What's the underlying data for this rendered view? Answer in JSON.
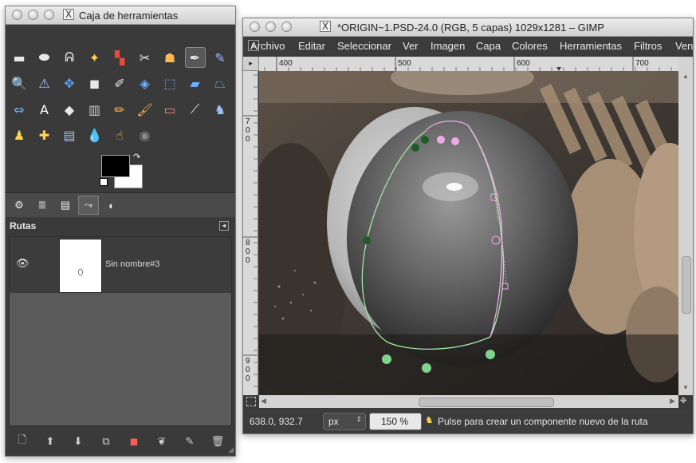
{
  "toolbox": {
    "title": "Caja de herramientas",
    "tools": [
      {
        "name": "rect-select-icon",
        "glyph": "▬",
        "color": "#e8e8e8"
      },
      {
        "name": "ellipse-select-icon",
        "glyph": "⬬",
        "color": "#e8e8e8"
      },
      {
        "name": "free-select-icon",
        "glyph": "ᕱ",
        "color": "#e8e8e8"
      },
      {
        "name": "fuzzy-select-icon",
        "glyph": "✦",
        "color": "#ffd34d"
      },
      {
        "name": "color-select-icon",
        "glyph": "▚",
        "color": "#e84a3c"
      },
      {
        "name": "scissors-select-icon",
        "glyph": "✂",
        "color": "#e8e8e8"
      },
      {
        "name": "foreground-select-icon",
        "glyph": "☗",
        "color": "#ffb84d"
      },
      {
        "name": "paths-tool-icon",
        "glyph": "✒",
        "color": "#e8e8e8"
      },
      {
        "name": "color-picker-icon",
        "glyph": "✎",
        "color": "#8fb8ff"
      },
      {
        "name": "zoom-icon",
        "glyph": "🔍",
        "color": "#9ec4ff"
      },
      {
        "name": "measure-icon",
        "glyph": "⚠",
        "color": "#9ec4ff"
      },
      {
        "name": "move-icon",
        "glyph": "✥",
        "color": "#5aa0ff"
      },
      {
        "name": "align-icon",
        "glyph": "◼",
        "color": "#e8e8e8"
      },
      {
        "name": "crop-icon",
        "glyph": "✐",
        "color": "#e8e8e8"
      },
      {
        "name": "rotate-icon",
        "glyph": "◈",
        "color": "#6fb0ff"
      },
      {
        "name": "scale-icon",
        "glyph": "⬚",
        "color": "#6fb0ff"
      },
      {
        "name": "shear-icon",
        "glyph": "▰",
        "color": "#6fb0ff"
      },
      {
        "name": "perspective-icon",
        "glyph": "⏢",
        "color": "#6fb0ff"
      },
      {
        "name": "flip-icon",
        "glyph": "⇔",
        "color": "#6fb0ff"
      },
      {
        "name": "text-icon",
        "glyph": "A",
        "color": "#ffffff"
      },
      {
        "name": "bucket-fill-icon",
        "glyph": "◆",
        "color": "#e8e8e8"
      },
      {
        "name": "blend-icon",
        "glyph": "▥",
        "color": "#cccccc"
      },
      {
        "name": "pencil-icon",
        "glyph": "✏",
        "color": "#ffb84d"
      },
      {
        "name": "paintbrush-icon",
        "glyph": "🖌",
        "color": "#ffb84d"
      },
      {
        "name": "eraser-icon",
        "glyph": "▭",
        "color": "#ff7d8a"
      },
      {
        "name": "airbrush-icon",
        "glyph": "⟋",
        "color": "#e8e8e8"
      },
      {
        "name": "ink-icon",
        "glyph": "♞",
        "color": "#9ec4ff"
      },
      {
        "name": "clone-icon",
        "glyph": "♟",
        "color": "#ffd34d"
      },
      {
        "name": "heal-icon",
        "glyph": "✚",
        "color": "#ffd34d"
      },
      {
        "name": "perspective-clone-icon",
        "glyph": "▤",
        "color": "#9ec4ff"
      },
      {
        "name": "blur-icon",
        "glyph": "💧",
        "color": "#6fb0ff"
      },
      {
        "name": "smudge-icon",
        "glyph": "☝",
        "color": "#ffb84d"
      },
      {
        "name": "dodge-burn-icon",
        "glyph": "◉",
        "color": "#888888"
      }
    ],
    "tabs": [
      {
        "name": "tab-tool-options",
        "glyph": "⚙"
      },
      {
        "name": "tab-layers",
        "glyph": "≣"
      },
      {
        "name": "tab-channels",
        "glyph": "▤"
      },
      {
        "name": "tab-paths",
        "glyph": "⤳"
      },
      {
        "name": "tab-gradients",
        "glyph": "◐"
      }
    ],
    "panel_title": "Rutas",
    "path_name": "Sin nombre#3",
    "bottom_buttons": [
      {
        "name": "new-path-button",
        "glyph": "🗋"
      },
      {
        "name": "raise-path-button",
        "glyph": "⬆"
      },
      {
        "name": "lower-path-button",
        "glyph": "⬇"
      },
      {
        "name": "duplicate-path-button",
        "glyph": "⧉"
      },
      {
        "name": "path-to-selection-button",
        "glyph": "◼"
      },
      {
        "name": "selection-to-path-button",
        "glyph": "❦"
      },
      {
        "name": "paint-along-path-button",
        "glyph": "✎"
      },
      {
        "name": "delete-path-button",
        "glyph": "🗑"
      }
    ]
  },
  "image_window": {
    "title": "*ORIGIN~1.PSD-24.0 (RGB, 5 capas) 1029x1281 – GIMP",
    "menus": [
      "Archivo",
      "Editar",
      "Seleccionar",
      "Ver",
      "Imagen",
      "Capa",
      "Colores",
      "Herramientas",
      "Filtros",
      "Ven"
    ],
    "ruler_labels_h": [
      "400",
      "500",
      "600",
      "700"
    ],
    "ruler_labels_v": [
      "700",
      "800",
      "900"
    ],
    "status": {
      "coords": "638.0, 932.7",
      "unit": "px",
      "zoom": "150 %",
      "message": "Pulse para crear un componente nuevo de la ruta"
    }
  },
  "colors": {
    "toolbox_bg": "#3a3a3a",
    "path_stroke_green": "#a5e6a5",
    "path_stroke_pink": "#f0a8e8",
    "anchor_green": "#7fd38a",
    "anchor_dark": "#1f5a2a"
  }
}
